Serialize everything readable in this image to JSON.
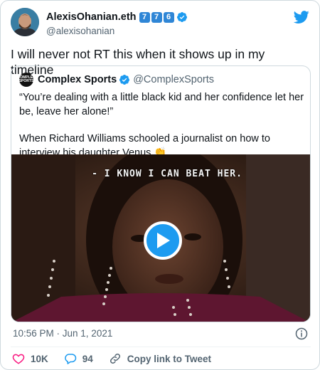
{
  "author": {
    "display_name": "AlexisOhanian.eth",
    "badges": [
      "7",
      "7",
      "6"
    ],
    "handle": "@alexisohanian"
  },
  "tweet_text": "I will never not RT this when it shows up in my timeline",
  "quoted": {
    "avatar_text": "COMPLEX SPORTS",
    "display_name": "Complex Sports",
    "handle": "@ComplexSports",
    "paragraph1": "“You’re dealing with a little black kid and her confidence let her be, leave her alone!”",
    "paragraph2": "When Richard Williams schooled a journalist on how to interview his daughter Venus 👏",
    "video_caption": "- I KNOW I CAN BEAT HER."
  },
  "timestamp": "10:56 PM · Jun 1, 2021",
  "actions": {
    "likes": "10K",
    "replies": "94",
    "copy_link": "Copy link to Tweet"
  },
  "colors": {
    "accent": "#1d9bf0",
    "like": "#f91880",
    "secondary_text": "#536471",
    "keycap": "#2f86d6"
  },
  "icons": [
    "verified-badge-icon",
    "twitter-bird-icon",
    "play-icon",
    "info-icon",
    "heart-icon",
    "reply-icon",
    "link-icon"
  ]
}
